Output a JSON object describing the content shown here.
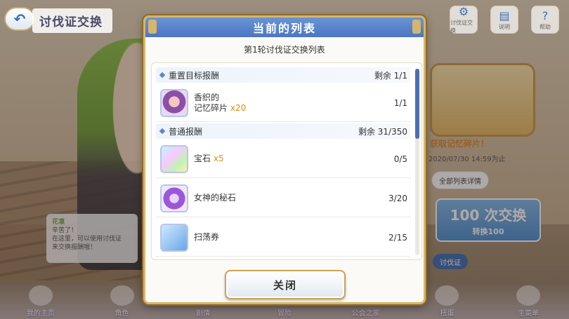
{
  "screen": {
    "title": "讨伐证交换",
    "back_label": "⟲"
  },
  "top_icons": [
    {
      "icon": "gear-icon",
      "label": "讨伐证交换"
    },
    {
      "icon": "book-icon",
      "label": "说明"
    },
    {
      "icon": "help-icon",
      "label": "帮助"
    }
  ],
  "modal": {
    "title": "当前的列表",
    "subtitle": "第1轮讨伐证交换列表",
    "sections": [
      {
        "label": "重置目标报酬",
        "remaining": "剩余 1/1",
        "items": [
          {
            "name": "香织的",
            "name_line2": "记忆碎片",
            "qty": "x20",
            "count": "1/1",
            "icon": "kaori-shard-icon"
          }
        ]
      },
      {
        "label": "普通报酬",
        "remaining": "剩余 31/350",
        "items": [
          {
            "name": "宝石",
            "name_line2": "",
            "qty": "x5",
            "count": "0/5",
            "icon": "gem-icon"
          },
          {
            "name": "女神的秘石",
            "name_line2": "",
            "qty": "",
            "count": "3/20",
            "icon": "goddess-stone-icon"
          },
          {
            "name": "扫荡券",
            "name_line2": "",
            "qty": "",
            "count": "2/15",
            "icon": "sweep-ticket-icon"
          }
        ]
      }
    ],
    "scroll_position": 0.0,
    "close_label": "关闭"
  },
  "right_panel": {
    "banner": "获取记忆碎片！",
    "date": "2020/07/30 14:59为止",
    "pills": [
      "全部列表详情"
    ],
    "exchange_count": "100 次交换",
    "exchange_sub": "转换100",
    "ticket": "讨伐证"
  },
  "speech": {
    "name": "花凛",
    "text": "辛苦了！\n在这里，可以使用讨伐证\n来交换报酬哦！"
  },
  "bottom_nav": [
    "我的主页",
    "角色",
    "剧情",
    "冒险",
    "公会之家",
    "扭蛋",
    "主菜单"
  ],
  "colors": {
    "header_blue": "#4b76c2",
    "gold_border": "#d6b66a",
    "qty_orange": "#e08a12",
    "scroll_thumb": "#4d6fb0"
  }
}
